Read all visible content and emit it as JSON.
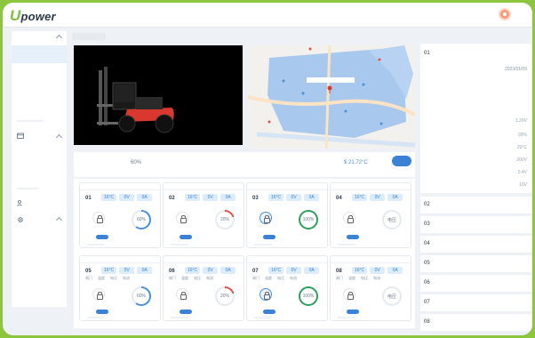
{
  "app": {
    "logo_u": "U",
    "logo_rest": "power"
  },
  "status": {
    "percent": "60%",
    "temperature": "$ 21.72°C"
  },
  "units": [
    {
      "id": "01",
      "temp": "16°C",
      "v": "0V",
      "a": "0A",
      "pct": "60%",
      "ring": "#4a90d9",
      "active": false,
      "arc": 0.6
    },
    {
      "id": "02",
      "temp": "16°C",
      "v": "0V",
      "a": "0A",
      "pct": "20%",
      "ring": "#d9534f",
      "active": false,
      "arc": 0.2
    },
    {
      "id": "03",
      "temp": "16°C",
      "v": "0V",
      "a": "0A",
      "pct": "100%",
      "ring": "#2e9e5b",
      "active": true,
      "arc": 1.0
    },
    {
      "id": "04",
      "temp": "16°C",
      "v": "0V",
      "a": "0A",
      "pct": "电压",
      "ring": "#cfd6de",
      "active": false,
      "arc": 0.0
    },
    {
      "id": "05",
      "temp": "16°C",
      "v": "0V",
      "a": "0A",
      "pct": "60%",
      "ring": "#4a90d9",
      "active": false,
      "arc": 0.6
    },
    {
      "id": "06",
      "temp": "16°C",
      "v": "0V",
      "a": "0A",
      "pct": "20%",
      "ring": "#d9534f",
      "active": false,
      "arc": 0.2
    },
    {
      "id": "07",
      "temp": "16°C",
      "v": "0V",
      "a": "0A",
      "pct": "100%",
      "ring": "#2e9e5b",
      "active": true,
      "arc": 1.0
    },
    {
      "id": "08",
      "temp": "16°C",
      "v": "0V",
      "a": "0A",
      "pct": "电压",
      "ring": "#cfd6de",
      "active": false,
      "arc": 0.0
    }
  ],
  "card_sub": {
    "door": "闸门",
    "temp": "温度",
    "volt": "电压",
    "current": "电流"
  },
  "right_panel": {
    "id": "01",
    "date": "2023/01/09",
    "values": [
      "1.20V",
      "99%",
      "20°C",
      "200V",
      "0.4V",
      "10V"
    ],
    "rows": [
      "02",
      "03",
      "04",
      "05",
      "06",
      "07",
      "08"
    ]
  }
}
